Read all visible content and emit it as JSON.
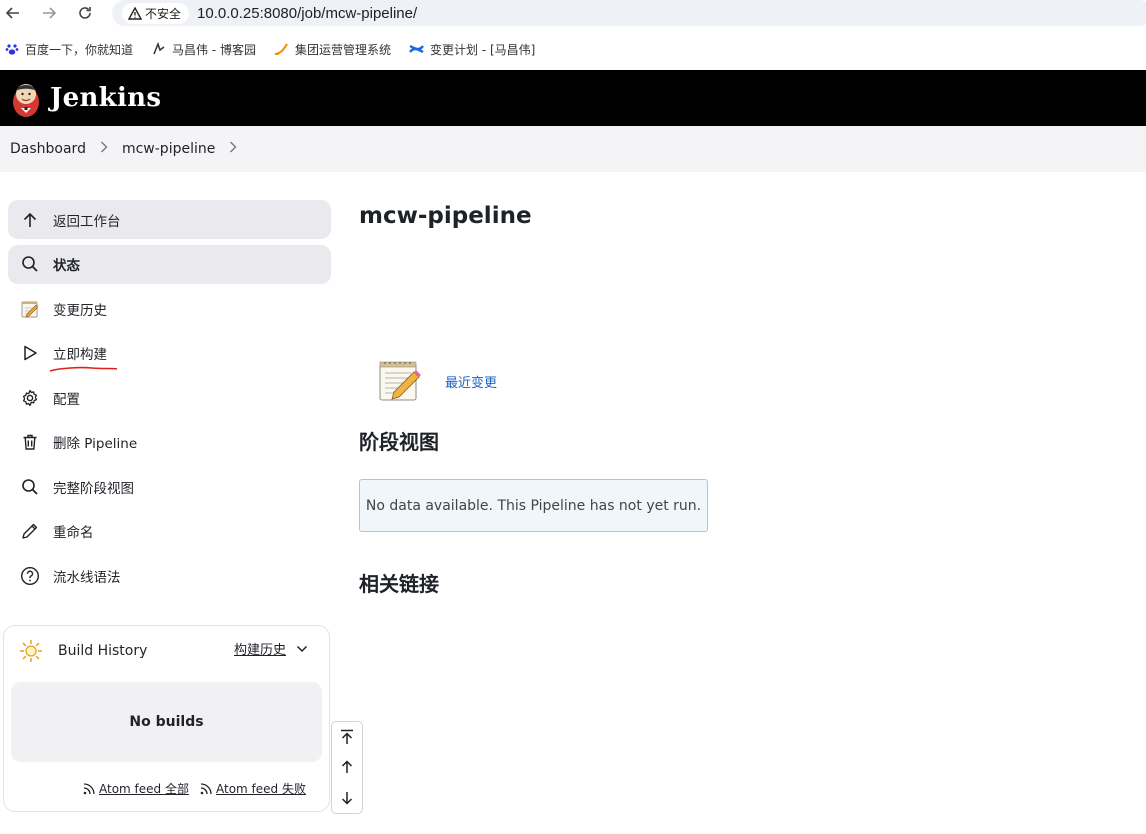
{
  "browser": {
    "security_label": "不安全",
    "url": "10.0.0.25:8080/job/mcw-pipeline/",
    "bookmarks": [
      {
        "label": "百度一下，你就知道",
        "icon": "baidu-paw-icon"
      },
      {
        "label": "马昌伟 - 博客园",
        "icon": "cnblogs-icon"
      },
      {
        "label": "集团运营管理系统",
        "icon": "swoosh-icon"
      },
      {
        "label": "变更计划 - [马昌伟]",
        "icon": "confluence-icon"
      }
    ]
  },
  "header": {
    "title": "Jenkins",
    "logo": "jenkins-butler-logo"
  },
  "breadcrumb": {
    "items": [
      "Dashboard",
      "mcw-pipeline"
    ]
  },
  "sidebar": {
    "items": [
      {
        "label": "返回工作台",
        "icon": "arrow-up-icon"
      },
      {
        "label": "状态",
        "icon": "search-icon"
      },
      {
        "label": "变更历史",
        "icon": "notepad-icon"
      },
      {
        "label": "立即构建",
        "icon": "play-icon"
      },
      {
        "label": "配置",
        "icon": "gear-icon"
      },
      {
        "label": "删除 Pipeline",
        "icon": "trash-icon"
      },
      {
        "label": "完整阶段视图",
        "icon": "search-icon"
      },
      {
        "label": "重命名",
        "icon": "pencil-icon"
      },
      {
        "label": "流水线语法",
        "icon": "help-icon"
      }
    ]
  },
  "build_history": {
    "title": "Build History",
    "trend_link": "构建历史",
    "empty_text": "No builds",
    "feed_all": "Atom feed 全部",
    "feed_failed": "Atom feed 失败"
  },
  "main": {
    "title": "mcw-pipeline",
    "recent_changes": "最近变更",
    "stage_view_heading": "阶段视图",
    "no_data_text": "No data available. This Pipeline has not yet run.",
    "related_links_heading": "相关链接"
  },
  "colors": {
    "link": "#1a62c6",
    "header_bg": "#000000",
    "annotation_red": "#e0201b"
  }
}
